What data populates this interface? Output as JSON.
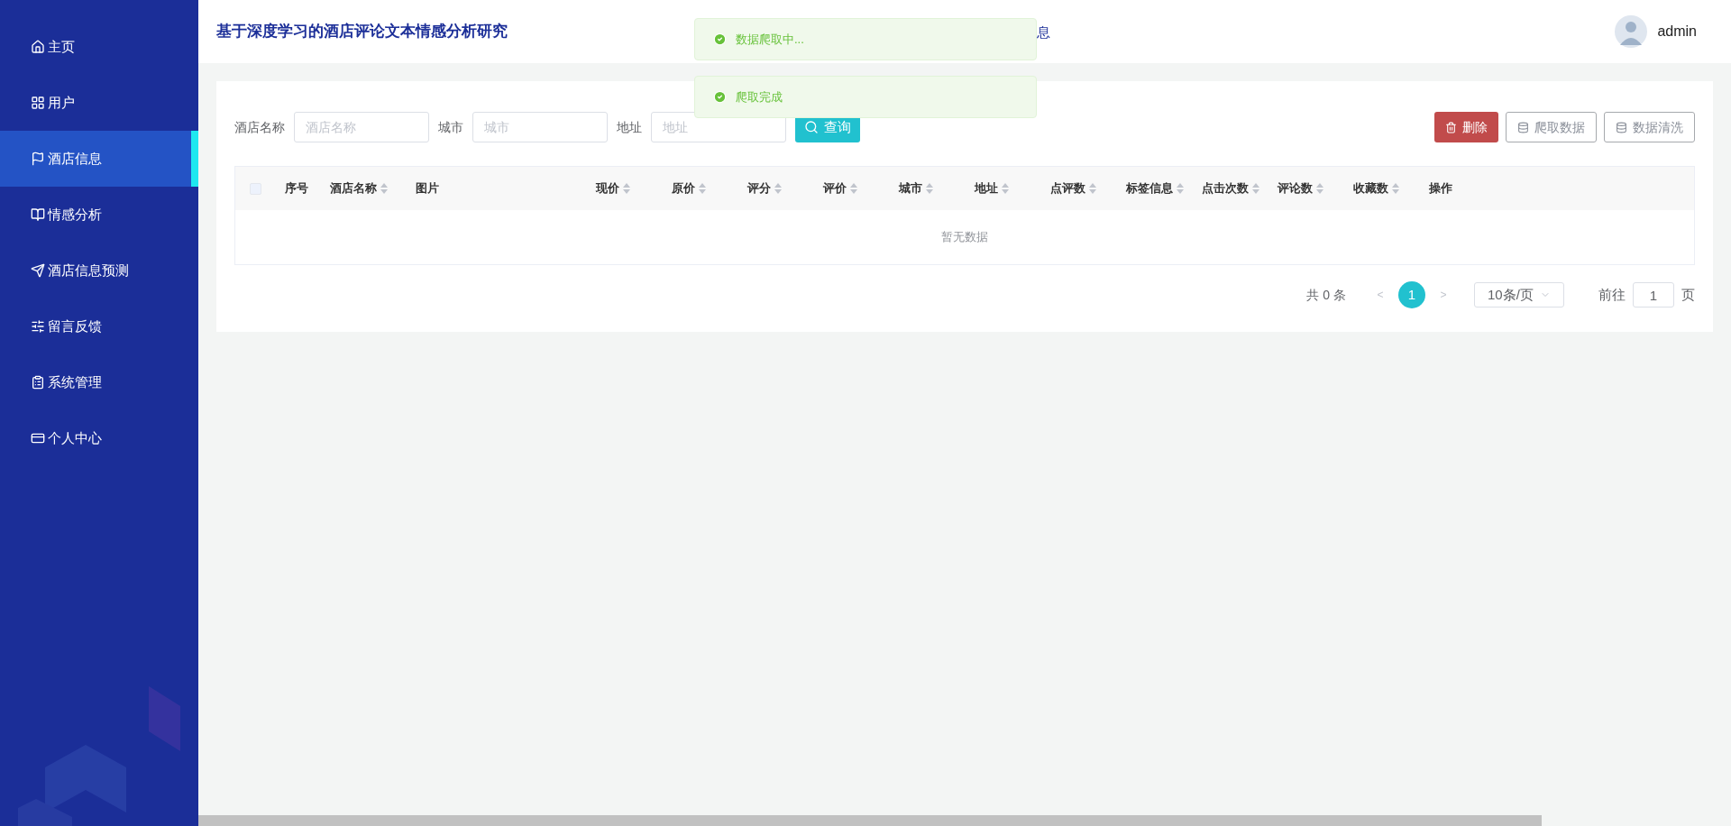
{
  "sidebar": {
    "items": [
      {
        "label": "主页",
        "selected": false
      },
      {
        "label": "用户",
        "selected": false
      },
      {
        "label": "酒店信息",
        "selected": true
      },
      {
        "label": "情感分析",
        "selected": false
      },
      {
        "label": "酒店信息预测",
        "selected": false
      },
      {
        "label": "留言反馈",
        "selected": false
      },
      {
        "label": "系统管理",
        "selected": false
      },
      {
        "label": "个人中心",
        "selected": false
      }
    ]
  },
  "header": {
    "title": "基于深度学习的酒店评论文本情感分析研究",
    "nav_fragment": "息",
    "user": "admin"
  },
  "toasts": [
    {
      "text": "数据爬取中..."
    },
    {
      "text": "爬取完成"
    }
  ],
  "filters": [
    {
      "label": "酒店名称",
      "placeholder": "酒店名称"
    },
    {
      "label": "城市",
      "placeholder": "城市"
    },
    {
      "label": "地址",
      "placeholder": "地址"
    }
  ],
  "search_button": "查询",
  "actions": [
    {
      "label": "删除",
      "kind": "danger"
    },
    {
      "label": "爬取数据",
      "kind": "plain"
    },
    {
      "label": "数据清洗",
      "kind": "plain"
    }
  ],
  "table": {
    "select_all": {
      "checked": false
    },
    "columns": [
      {
        "label": "序号",
        "sortable": false
      },
      {
        "label": "酒店名称",
        "sortable": true
      },
      {
        "label": "图片",
        "sortable": false
      },
      {
        "label": "现价",
        "sortable": true
      },
      {
        "label": "原价",
        "sortable": true
      },
      {
        "label": "评分",
        "sortable": true
      },
      {
        "label": "评价",
        "sortable": true
      },
      {
        "label": "城市",
        "sortable": true
      },
      {
        "label": "地址",
        "sortable": true
      },
      {
        "label": "点评数",
        "sortable": true
      },
      {
        "label": "标签信息",
        "sortable": true
      },
      {
        "label": "点击次数",
        "sortable": true
      },
      {
        "label": "评论数",
        "sortable": true
      },
      {
        "label": "收藏数",
        "sortable": true
      },
      {
        "label": "操作",
        "sortable": false
      }
    ],
    "empty_text": "暂无数据"
  },
  "pagination": {
    "total": "共 0 条",
    "prev": "<",
    "pages": [
      {
        "label": "1",
        "selected": true
      }
    ],
    "next": ">",
    "page_size": "10条/页",
    "goto_label": "前往",
    "goto_value": "1",
    "goto_suffix": "页"
  }
}
